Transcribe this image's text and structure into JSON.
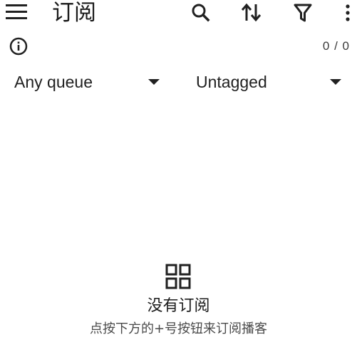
{
  "app_bar": {
    "title": "订阅",
    "icons": {
      "menu": "hamburger-menu-icon",
      "search": "search-icon",
      "sort": "sort-icon",
      "filter": "filter-icon",
      "more": "more-vert-icon"
    }
  },
  "info_row": {
    "info_icon": "info-icon",
    "counter": "0 / 0"
  },
  "filters": {
    "queue": {
      "selected": "Any queue",
      "icon": "dropdown-caret-icon"
    },
    "tag": {
      "selected": "Untagged",
      "icon": "dropdown-caret-icon"
    }
  },
  "empty_state": {
    "icon": "grid-icon",
    "title": "没有订阅",
    "hint": "点按下方的+号按钮来订阅播客"
  },
  "colors": {
    "icon": "#212121",
    "text_primary": "#1b1b1b",
    "text_secondary": "#4a4a4a",
    "background": "#ffffff"
  }
}
